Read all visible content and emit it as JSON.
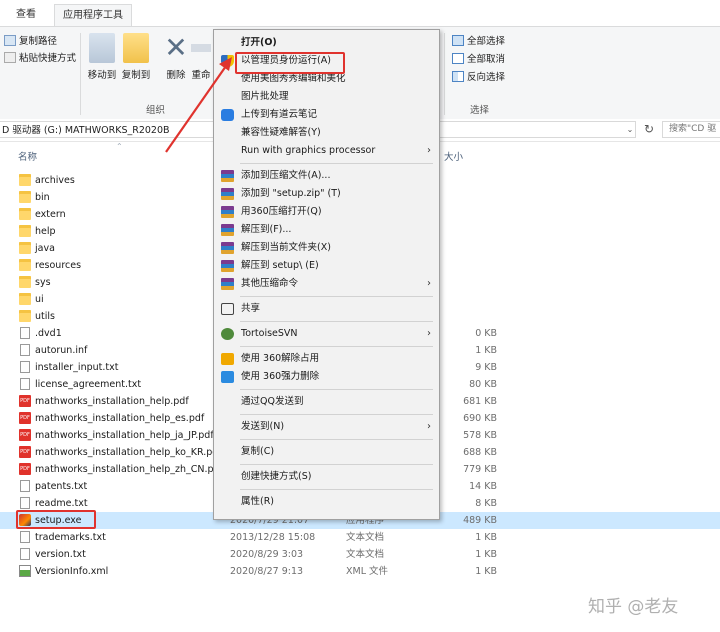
{
  "ribbon": {
    "tabs": [
      "查看",
      "应用程序工具"
    ],
    "clipboard_items": [
      "复制路径",
      "粘贴快捷方式"
    ],
    "organize_buttons": [
      "移动到",
      "复制到",
      "删除",
      "重命"
    ],
    "organize_label": "组织",
    "select_items": [
      "全部选择",
      "全部取消",
      "反向选择"
    ],
    "select_label": "选择"
  },
  "address": {
    "path": "D 驱动器 (G:) MATHWORKS_R2020B",
    "search_placeholder": "搜索\"CD 驱"
  },
  "columns": {
    "name": "名称",
    "size": "大小"
  },
  "files": [
    {
      "name": "archives",
      "date": "",
      "type": "",
      "size": "",
      "kind": "folder"
    },
    {
      "name": "bin",
      "date": "",
      "type": "",
      "size": "",
      "kind": "folder"
    },
    {
      "name": "extern",
      "date": "",
      "type": "",
      "size": "",
      "kind": "folder"
    },
    {
      "name": "help",
      "date": "",
      "type": "",
      "size": "",
      "kind": "folder"
    },
    {
      "name": "java",
      "date": "",
      "type": "",
      "size": "",
      "kind": "folder"
    },
    {
      "name": "resources",
      "date": "",
      "type": "",
      "size": "",
      "kind": "folder"
    },
    {
      "name": "sys",
      "date": "",
      "type": "",
      "size": "",
      "kind": "folder"
    },
    {
      "name": "ui",
      "date": "",
      "type": "",
      "size": "",
      "kind": "folder"
    },
    {
      "name": "utils",
      "date": "",
      "type": "",
      "size": "",
      "kind": "folder"
    },
    {
      "name": ".dvd1",
      "date": "",
      "type": "",
      "size": "0 KB",
      "kind": "file"
    },
    {
      "name": "autorun.inf",
      "date": "",
      "type": "",
      "size": "1 KB",
      "kind": "file"
    },
    {
      "name": "installer_input.txt",
      "date": "",
      "type": "",
      "size": "9 KB",
      "kind": "file"
    },
    {
      "name": "license_agreement.txt",
      "date": "",
      "type": "",
      "size": "80 KB",
      "kind": "file"
    },
    {
      "name": "mathworks_installation_help.pdf",
      "date": "",
      "type": "",
      "size": "681 KB",
      "kind": "pdf"
    },
    {
      "name": "mathworks_installation_help_es.pdf",
      "date": "",
      "type": "",
      "size": "690 KB",
      "kind": "pdf"
    },
    {
      "name": "mathworks_installation_help_ja_JP.pdf",
      "date": "",
      "type": "",
      "size": "578 KB",
      "kind": "pdf"
    },
    {
      "name": "mathworks_installation_help_ko_KR.pdf",
      "date": "",
      "type": "",
      "size": "688 KB",
      "kind": "pdf"
    },
    {
      "name": "mathworks_installation_help_zh_CN.pdf",
      "date": "",
      "type": "",
      "size": "779 KB",
      "kind": "pdf"
    },
    {
      "name": "patents.txt",
      "date": "",
      "type": "",
      "size": "14 KB",
      "kind": "file"
    },
    {
      "name": "readme.txt",
      "date": "",
      "type": "",
      "size": "8 KB",
      "kind": "file"
    },
    {
      "name": "setup.exe",
      "date": "2020/7/29 21:07",
      "type": "应用程序",
      "size": "489 KB",
      "kind": "exe"
    },
    {
      "name": "trademarks.txt",
      "date": "2013/12/28 15:08",
      "type": "文本文档",
      "size": "1 KB",
      "kind": "file"
    },
    {
      "name": "version.txt",
      "date": "2020/8/29 3:03",
      "type": "文本文档",
      "size": "1 KB",
      "kind": "file"
    },
    {
      "name": "VersionInfo.xml",
      "date": "2020/8/27 9:13",
      "type": "XML 文件",
      "size": "1 KB",
      "kind": "xml"
    }
  ],
  "context_menu": [
    {
      "label": "打开(O)",
      "bold": true
    },
    {
      "label": "以管理员身份运行(A)",
      "icon": "shield-icon"
    },
    {
      "label": "使用美图秀秀编辑和美化"
    },
    {
      "label": "图片批处理"
    },
    {
      "label": "上传到有道云笔记",
      "icon": "youdao-icon"
    },
    {
      "label": "兼容性疑难解答(Y)"
    },
    {
      "label": "Run with graphics processor",
      "submenu": true
    },
    {
      "sep": true
    },
    {
      "label": "添加到压缩文件(A)...",
      "icon": "winrar-icon"
    },
    {
      "label": "添加到 \"setup.zip\" (T)",
      "icon": "winrar-icon"
    },
    {
      "label": "用360压缩打开(Q)",
      "icon": "winrar-icon"
    },
    {
      "label": "解压到(F)...",
      "icon": "winrar-icon"
    },
    {
      "label": "解压到当前文件夹(X)",
      "icon": "winrar-icon"
    },
    {
      "label": "解压到 setup\\ (E)",
      "icon": "winrar-icon"
    },
    {
      "label": "其他压缩命令",
      "icon": "winrar-icon",
      "submenu": true
    },
    {
      "sep": true
    },
    {
      "label": "共享",
      "icon": "share-icon"
    },
    {
      "sep": true
    },
    {
      "label": "TortoiseSVN",
      "icon": "tortoise-icon",
      "submenu": true
    },
    {
      "sep": true
    },
    {
      "label": "使用 360解除占用",
      "icon": "360-unlock-icon"
    },
    {
      "label": "使用 360强力删除",
      "icon": "360-delete-icon"
    },
    {
      "sep": true
    },
    {
      "label": "通过QQ发送到"
    },
    {
      "sep": true
    },
    {
      "label": "发送到(N)",
      "submenu": true
    },
    {
      "sep": true
    },
    {
      "label": "复制(C)"
    },
    {
      "sep": true
    },
    {
      "label": "创建快捷方式(S)"
    },
    {
      "sep": true
    },
    {
      "label": "属性(R)"
    }
  ],
  "watermark": "知乎 @老友",
  "colors": {
    "annotation": "#e0332e",
    "selection": "#cce8ff",
    "accent": "#0078d7"
  }
}
